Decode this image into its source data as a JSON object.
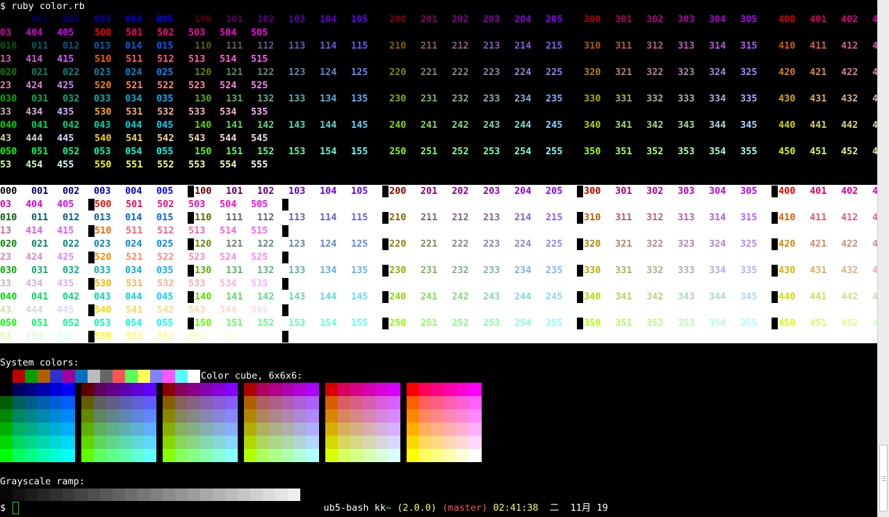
{
  "terminal": {
    "command_line": "$ ruby color.rb",
    "system_colors_label": "System colors:",
    "color_cube_label": "Color cube, 6x6x6:",
    "grayscale_label": "Grayscale ramp:",
    "prompt": {
      "host": "ub5-bash",
      "user": "kk",
      "path": "~",
      "ruby_version": "(2.0.0)",
      "git_branch": "(master)",
      "time": "02:41:38",
      "date": "二  11月 19",
      "final_prompt": "$"
    },
    "color_codes_first_row": [
      "000",
      "001",
      "002",
      "003",
      "004",
      "005",
      "100",
      "101",
      "102",
      "103",
      "104",
      "105",
      "200",
      "201",
      "202",
      "203",
      "204",
      "205",
      "300",
      "301",
      "302",
      "303",
      "304",
      "305",
      "400",
      "401",
      "402",
      "403",
      "404",
      "405",
      "500",
      "501",
      "502",
      "503",
      "504",
      "505"
    ],
    "row_prefixes": [
      "0",
      "1",
      "2",
      "3",
      "4",
      "5"
    ],
    "system_palette": [
      "#000000",
      "#c00000",
      "#00a000",
      "#b06000",
      "#3030d0",
      "#a000a0",
      "#0070c0",
      "#bbbbbb",
      "#666666",
      "#ff5555",
      "#55ff55",
      "#ffff55",
      "#8080ff",
      "#ff55ff",
      "#55ffff",
      "#ffffff"
    ],
    "colors": {
      "cube_steps": [
        0,
        95,
        135,
        175,
        215,
        255
      ]
    }
  }
}
